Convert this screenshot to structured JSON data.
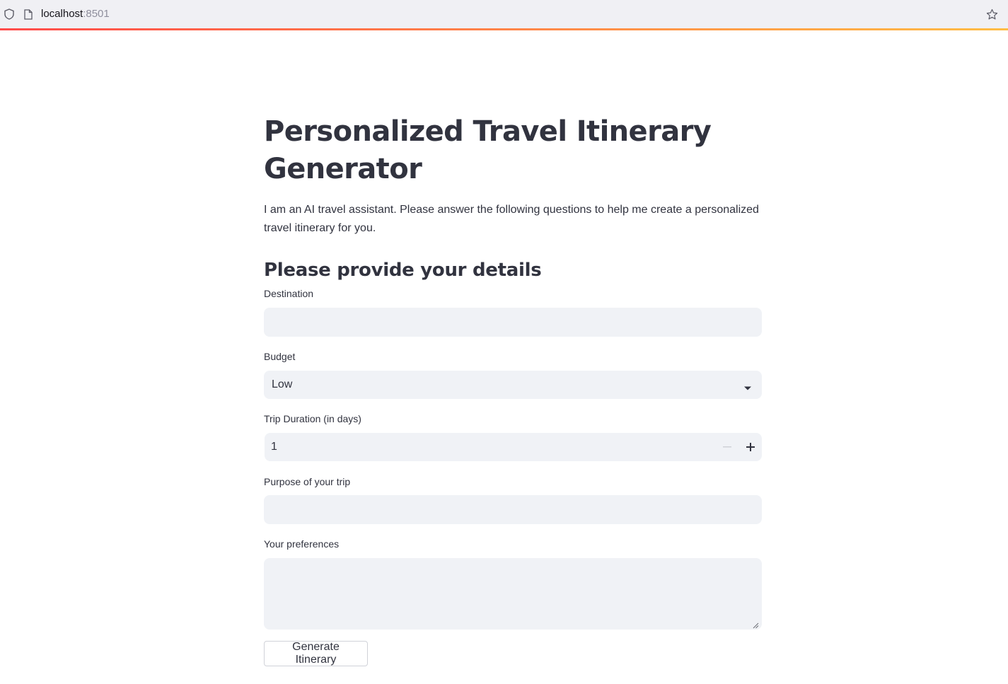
{
  "browser": {
    "url_host": "localhost",
    "url_port": ":8501"
  },
  "page": {
    "title": "Personalized Travel Itinerary Generator",
    "intro": "I am an AI travel assistant. Please answer the following questions to help me create a personalized travel itinerary for you.",
    "subheader": "Please provide your details"
  },
  "form": {
    "destination": {
      "label": "Destination",
      "value": "",
      "placeholder": ""
    },
    "budget": {
      "label": "Budget",
      "selected": "Low"
    },
    "duration": {
      "label": "Trip Duration (in days)",
      "value": "1"
    },
    "purpose": {
      "label": "Purpose of your trip",
      "value": "",
      "placeholder": ""
    },
    "preferences": {
      "label": "Your preferences",
      "value": ""
    },
    "submit_label": "Generate Itinerary"
  },
  "colors": {
    "accent_gradient_start": "#ff4b4b",
    "accent_gradient_end": "#ffbd45",
    "input_bg": "#f0f2f6",
    "text": "#31333f"
  },
  "icons": [
    "shield-icon",
    "page-icon",
    "star-icon",
    "chevron-down-icon",
    "minus-icon",
    "plus-icon",
    "resize-grip-icon"
  ]
}
